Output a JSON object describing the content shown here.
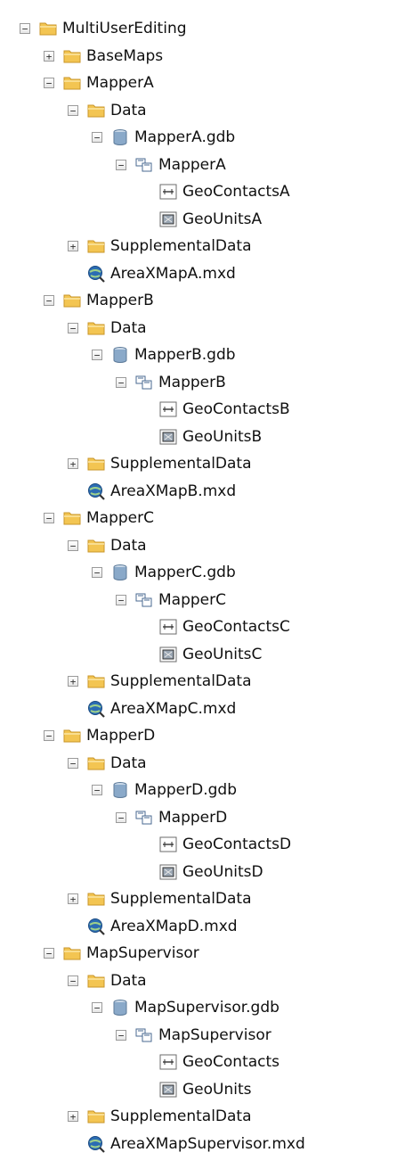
{
  "tree": {
    "items": [
      {
        "label": "MultiUserEditing",
        "type": "folder",
        "level": 0,
        "state": "expanded"
      },
      {
        "label": "BaseMaps",
        "type": "folder",
        "level": 1,
        "state": "collapsed"
      },
      {
        "label": "MapperA",
        "type": "folder",
        "level": 1,
        "state": "expanded"
      },
      {
        "label": "Data",
        "type": "folder",
        "level": 2,
        "state": "expanded"
      },
      {
        "label": "MapperA.gdb",
        "type": "gdb",
        "level": 3,
        "state": "expanded"
      },
      {
        "label": "MapperA",
        "type": "dataset",
        "level": 4,
        "state": "expanded"
      },
      {
        "label": "GeoContactsA",
        "type": "line-fc",
        "level": 5,
        "state": "leaf"
      },
      {
        "label": "GeoUnitsA",
        "type": "poly-fc",
        "level": 5,
        "state": "leaf"
      },
      {
        "label": "SupplementalData",
        "type": "folder",
        "level": 2,
        "state": "collapsed"
      },
      {
        "label": "AreaXMapA.mxd",
        "type": "mxd",
        "level": 2,
        "state": "leaf"
      },
      {
        "label": "MapperB",
        "type": "folder",
        "level": 1,
        "state": "expanded"
      },
      {
        "label": "Data",
        "type": "folder",
        "level": 2,
        "state": "expanded"
      },
      {
        "label": "MapperB.gdb",
        "type": "gdb",
        "level": 3,
        "state": "expanded"
      },
      {
        "label": "MapperB",
        "type": "dataset",
        "level": 4,
        "state": "expanded"
      },
      {
        "label": "GeoContactsB",
        "type": "line-fc",
        "level": 5,
        "state": "leaf"
      },
      {
        "label": "GeoUnitsB",
        "type": "poly-fc",
        "level": 5,
        "state": "leaf"
      },
      {
        "label": "SupplementalData",
        "type": "folder",
        "level": 2,
        "state": "collapsed"
      },
      {
        "label": "AreaXMapB.mxd",
        "type": "mxd",
        "level": 2,
        "state": "leaf"
      },
      {
        "label": "MapperC",
        "type": "folder",
        "level": 1,
        "state": "expanded"
      },
      {
        "label": "Data",
        "type": "folder",
        "level": 2,
        "state": "expanded"
      },
      {
        "label": "MapperC.gdb",
        "type": "gdb",
        "level": 3,
        "state": "expanded"
      },
      {
        "label": "MapperC",
        "type": "dataset",
        "level": 4,
        "state": "expanded"
      },
      {
        "label": "GeoContactsC",
        "type": "line-fc",
        "level": 5,
        "state": "leaf"
      },
      {
        "label": "GeoUnitsC",
        "type": "poly-fc",
        "level": 5,
        "state": "leaf"
      },
      {
        "label": "SupplementalData",
        "type": "folder",
        "level": 2,
        "state": "collapsed"
      },
      {
        "label": "AreaXMapC.mxd",
        "type": "mxd",
        "level": 2,
        "state": "leaf"
      },
      {
        "label": "MapperD",
        "type": "folder",
        "level": 1,
        "state": "expanded"
      },
      {
        "label": "Data",
        "type": "folder",
        "level": 2,
        "state": "expanded"
      },
      {
        "label": "MapperD.gdb",
        "type": "gdb",
        "level": 3,
        "state": "expanded"
      },
      {
        "label": "MapperD",
        "type": "dataset",
        "level": 4,
        "state": "expanded"
      },
      {
        "label": "GeoContactsD",
        "type": "line-fc",
        "level": 5,
        "state": "leaf"
      },
      {
        "label": "GeoUnitsD",
        "type": "poly-fc",
        "level": 5,
        "state": "leaf"
      },
      {
        "label": "SupplementalData",
        "type": "folder",
        "level": 2,
        "state": "collapsed"
      },
      {
        "label": "AreaXMapD.mxd",
        "type": "mxd",
        "level": 2,
        "state": "leaf"
      },
      {
        "label": "MapSupervisor",
        "type": "folder",
        "level": 1,
        "state": "expanded"
      },
      {
        "label": "Data",
        "type": "folder",
        "level": 2,
        "state": "expanded"
      },
      {
        "label": "MapSupervisor.gdb",
        "type": "gdb",
        "level": 3,
        "state": "expanded"
      },
      {
        "label": "MapSupervisor",
        "type": "dataset",
        "level": 4,
        "state": "expanded"
      },
      {
        "label": "GeoContacts",
        "type": "line-fc",
        "level": 5,
        "state": "leaf"
      },
      {
        "label": "GeoUnits",
        "type": "poly-fc",
        "level": 5,
        "state": "leaf"
      },
      {
        "label": "SupplementalData",
        "type": "folder",
        "level": 2,
        "state": "collapsed"
      },
      {
        "label": "AreaXMapSupervisor.mxd",
        "type": "mxd",
        "level": 2,
        "state": "leaf"
      }
    ]
  },
  "icons": {
    "expanded": "minus-box-icon",
    "collapsed": "plus-box-icon",
    "folder": "folder-icon",
    "gdb": "geodatabase-icon",
    "dataset": "feature-dataset-icon",
    "line-fc": "line-feature-class-icon",
    "poly-fc": "polygon-feature-class-icon",
    "mxd": "map-document-icon"
  },
  "colors": {
    "folder": "#f3c552",
    "folder_edge": "#c8962a",
    "gdb": "#8aa9c9",
    "globe": "#2b6cb3",
    "text": "#101010"
  }
}
